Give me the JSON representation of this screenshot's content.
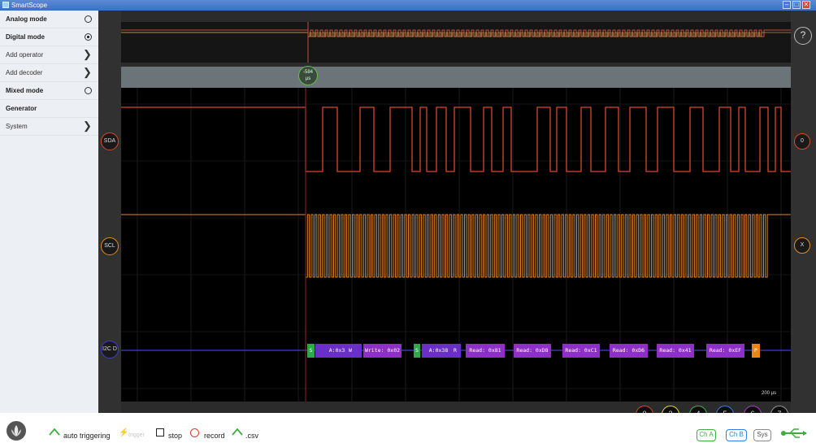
{
  "window": {
    "title": "SmartScope",
    "minimize": "–",
    "maximize": "□",
    "close": "✕"
  },
  "sidebar": {
    "items": [
      {
        "label": "Analog mode",
        "kind": "radio",
        "selected": false
      },
      {
        "label": "Digital mode",
        "kind": "radio",
        "selected": true
      },
      {
        "label": "Add operator",
        "kind": "submenu"
      },
      {
        "label": "Add decoder",
        "kind": "submenu"
      },
      {
        "label": "Mixed mode",
        "kind": "radio",
        "selected": false
      },
      {
        "label": "Generator",
        "kind": "plain"
      },
      {
        "label": "System",
        "kind": "submenu"
      }
    ],
    "chevron": "❯"
  },
  "scope": {
    "help": "?",
    "trigger_marker": {
      "value": "-584",
      "unit": "µs"
    },
    "channels": [
      {
        "name": "SDA",
        "color": "#d9482c",
        "edge_label": "0"
      },
      {
        "name": "SCL",
        "color": "#e08a2c",
        "edge_label": "X"
      },
      {
        "name": "I2C D",
        "color": "#3d3dd6"
      }
    ],
    "i2c_packets": [
      {
        "text": "S",
        "color": "#2ea84a"
      },
      {
        "text": "A:0x38",
        "color": "#6a2fc9"
      },
      {
        "text": "W",
        "color": "#6a2fc9"
      },
      {
        "text": "Write: 0x02",
        "color": "#8f2fc9"
      },
      {
        "text": "S",
        "color": "#2ea84a"
      },
      {
        "text": "A:0x38",
        "color": "#6a2fc9"
      },
      {
        "text": "R",
        "color": "#6a2fc9"
      },
      {
        "text": "Read: 0x81",
        "color": "#8f2fc9"
      },
      {
        "text": "Read: 0xD8",
        "color": "#8f2fc9"
      },
      {
        "text": "Read: 0xC1",
        "color": "#8f2fc9"
      },
      {
        "text": "Read: 0xD6",
        "color": "#8f2fc9"
      },
      {
        "text": "Read: 0x41",
        "color": "#8f2fc9"
      },
      {
        "text": "Read: 0xEF",
        "color": "#8f2fc9"
      },
      {
        "text": "P",
        "color": "#e8861a"
      }
    ],
    "time_scale": "200 µs",
    "channel_buttons": [
      {
        "label": "0",
        "color": "#d9482c"
      },
      {
        "label": "3",
        "color": "#e3dd34"
      },
      {
        "label": "4",
        "color": "#3fb84f"
      },
      {
        "label": "5",
        "color": "#2f7fe8"
      },
      {
        "label": "6",
        "color": "#b03fc9"
      },
      {
        "label": "7",
        "color": "#9a9a9a"
      }
    ]
  },
  "bottombar": {
    "auto_triggering": "auto triggering",
    "trigger": "trigger",
    "stop": "stop",
    "record": "record",
    "csv": ".csv",
    "ch_a": "Ch A",
    "ch_b": "Ch B",
    "sys": "Sys"
  }
}
